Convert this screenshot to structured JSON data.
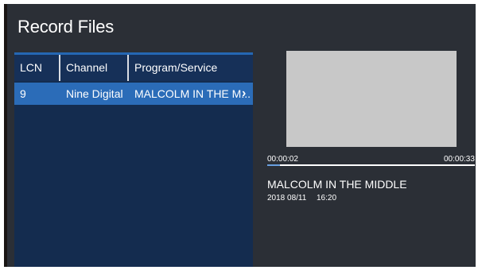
{
  "screen": {
    "title": "Record Files"
  },
  "table": {
    "columns": [
      "LCN",
      "Channel",
      "Program/Service"
    ],
    "rows": [
      {
        "lcn": "9",
        "channel": "Nine Digital",
        "program": "MALCOLM IN THE M...",
        "icon": "chevron-right-icon"
      }
    ]
  },
  "preview": {
    "time_start": "00:00:02",
    "time_end": "00:00:33",
    "progress": 0.06,
    "program_title": "MALCOLM IN THE MIDDLE",
    "date": "2018 08/11",
    "time": "16:20"
  },
  "colors": {
    "background": "#2b2f36",
    "list_panel": "#142c4f",
    "selected_row": "#2b6cb8",
    "video_placeholder": "#c8c8c8"
  }
}
